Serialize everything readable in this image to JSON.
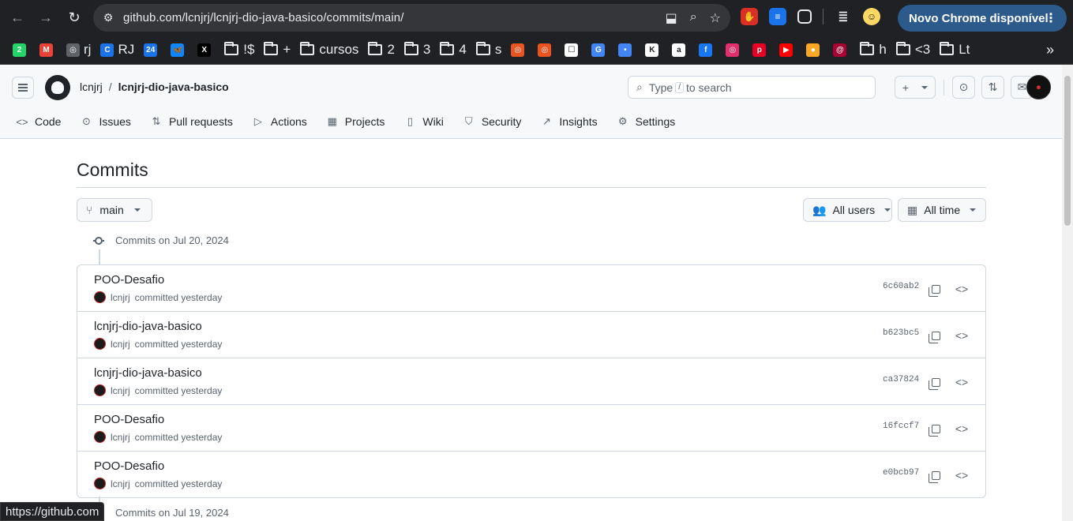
{
  "browser": {
    "url": "github.com/lcnjrj/lcnjrj-dio-java-basico/commits/main/",
    "update_label": "Novo Chrome disponível",
    "status_url": "https://github.com"
  },
  "bookmarks": [
    {
      "icon": "whatsapp-icon",
      "label": "",
      "color": "#25d366",
      "glyph": "2"
    },
    {
      "icon": "gmail-icon",
      "label": "",
      "color": "#ea4335",
      "glyph": "M"
    },
    {
      "icon": "globe-icon",
      "label": "rj",
      "color": "#5f6368",
      "glyph": "◎"
    },
    {
      "icon": "site-icon",
      "label": "RJ",
      "color": "#1a73e8",
      "glyph": "C"
    },
    {
      "icon": "calendar-icon",
      "label": "",
      "color": "#1a73e8",
      "glyph": "24"
    },
    {
      "icon": "bluesky-icon",
      "label": "",
      "color": "#1185fe",
      "glyph": "🦋"
    },
    {
      "icon": "x-icon",
      "label": "",
      "color": "#000000",
      "glyph": "X"
    },
    {
      "icon": "folder-icon",
      "label": "!$",
      "folder": true
    },
    {
      "icon": "folder-icon",
      "label": "+",
      "folder": true
    },
    {
      "icon": "folder-icon",
      "label": "cursos",
      "folder": true
    },
    {
      "icon": "folder-icon",
      "label": "2",
      "folder": true
    },
    {
      "icon": "folder-icon",
      "label": "3",
      "folder": true
    },
    {
      "icon": "folder-icon",
      "label": "4",
      "folder": true
    },
    {
      "icon": "folder-icon",
      "label": "s",
      "folder": true
    },
    {
      "icon": "ubuntu-icon",
      "label": "",
      "color": "#e95420",
      "glyph": "◎"
    },
    {
      "icon": "ubuntu-icon",
      "label": "",
      "color": "#e95420",
      "glyph": "◎"
    },
    {
      "icon": "site-icon",
      "label": "",
      "color": "#ffffff",
      "glyph": "☐"
    },
    {
      "icon": "translate-icon",
      "label": "",
      "color": "#4285f4",
      "glyph": "G"
    },
    {
      "icon": "assistant-icon",
      "label": "",
      "color": "#4285f4",
      "glyph": "•"
    },
    {
      "icon": "site-icon",
      "label": "",
      "color": "#ffffff",
      "glyph": "K"
    },
    {
      "icon": "amazon-icon",
      "label": "",
      "color": "#ffffff",
      "glyph": "a"
    },
    {
      "icon": "facebook-icon",
      "label": "",
      "color": "#1877f2",
      "glyph": "f"
    },
    {
      "icon": "instagram-icon",
      "label": "",
      "color": "#e1306c",
      "glyph": "◎"
    },
    {
      "icon": "pinterest-icon",
      "label": "",
      "color": "#e60023",
      "glyph": "p"
    },
    {
      "icon": "youtube-icon",
      "label": "",
      "color": "#ff0000",
      "glyph": "▶"
    },
    {
      "icon": "site-icon",
      "label": "",
      "color": "#f9a825",
      "glyph": "●"
    },
    {
      "icon": "debian-icon",
      "label": "",
      "color": "#a80030",
      "glyph": "@"
    },
    {
      "icon": "folder-icon",
      "label": "h",
      "folder": true
    },
    {
      "icon": "folder-icon",
      "label": "<3",
      "folder": true
    },
    {
      "icon": "folder-icon",
      "label": "Lt",
      "folder": true
    }
  ],
  "github": {
    "owner": "lcnjrj",
    "repo": "lcnjrj-dio-java-basico",
    "search_placeholder_pre": "Type",
    "search_key": "/",
    "search_placeholder_post": "to search",
    "tabs": [
      {
        "label": "Code",
        "icon": "code-icon",
        "glyph": "<>"
      },
      {
        "label": "Issues",
        "icon": "issues-icon",
        "glyph": "⊙"
      },
      {
        "label": "Pull requests",
        "icon": "pull-request-icon",
        "glyph": "⇅"
      },
      {
        "label": "Actions",
        "icon": "actions-icon",
        "glyph": "▷"
      },
      {
        "label": "Projects",
        "icon": "projects-icon",
        "glyph": "▦"
      },
      {
        "label": "Wiki",
        "icon": "wiki-icon",
        "glyph": "▯"
      },
      {
        "label": "Security",
        "icon": "shield-icon",
        "glyph": "⛉"
      },
      {
        "label": "Insights",
        "icon": "graph-icon",
        "glyph": "↗"
      },
      {
        "label": "Settings",
        "icon": "gear-icon",
        "glyph": "⚙"
      }
    ]
  },
  "page": {
    "title": "Commits",
    "branch": "main",
    "users_filter": "All users",
    "time_filter": "All time"
  },
  "groups": [
    {
      "heading": "Commits on Jul 20, 2024",
      "commits": [
        {
          "message": "POO-Desafio",
          "author": "lcnjrj",
          "meta": "committed yesterday",
          "sha": "6c60ab2"
        },
        {
          "message": "lcnjrj-dio-java-basico",
          "author": "lcnjrj",
          "meta": "committed yesterday",
          "sha": "b623bc5"
        },
        {
          "message": "lcnjrj-dio-java-basico",
          "author": "lcnjrj",
          "meta": "committed yesterday",
          "sha": "ca37824"
        },
        {
          "message": "POO-Desafio",
          "author": "lcnjrj",
          "meta": "committed yesterday",
          "sha": "16fccf7"
        },
        {
          "message": "POO-Desafio",
          "author": "lcnjrj",
          "meta": "committed yesterday",
          "sha": "e0bcb97"
        }
      ]
    },
    {
      "heading": "Commits on Jul 19, 2024",
      "commits": []
    }
  ]
}
